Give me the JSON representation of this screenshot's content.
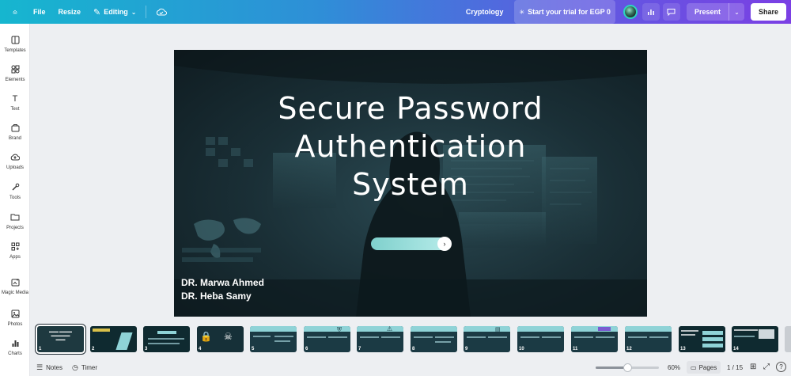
{
  "topbar": {
    "file_label": "File",
    "resize_label": "Resize",
    "editing_label": "Editing",
    "doc_title": "Cryptology",
    "trial_label": "Start your trial for EGP 0",
    "present_label": "Present",
    "share_label": "Share"
  },
  "sidebar": {
    "items": [
      {
        "label": "Templates",
        "icon": "templates-icon"
      },
      {
        "label": "Elements",
        "icon": "elements-icon"
      },
      {
        "label": "Text",
        "icon": "text-icon"
      },
      {
        "label": "Brand",
        "icon": "brand-icon"
      },
      {
        "label": "Uploads",
        "icon": "uploads-icon"
      },
      {
        "label": "Tools",
        "icon": "tools-icon"
      },
      {
        "label": "Projects",
        "icon": "projects-icon"
      },
      {
        "label": "Apps",
        "icon": "apps-icon"
      },
      {
        "label": "Magic Media",
        "icon": "magic-media-icon"
      },
      {
        "label": "Photos",
        "icon": "photos-icon"
      },
      {
        "label": "Charts",
        "icon": "charts-icon"
      }
    ]
  },
  "slide": {
    "title_line1": "Secure Password",
    "title_line2": "Authentication",
    "title_line3": "System",
    "author1": "DR. Marwa Ahmed",
    "author2": "DR. Heba Samy"
  },
  "filmstrip": {
    "thumbs": [
      {
        "num": "1"
      },
      {
        "num": "2"
      },
      {
        "num": "3"
      },
      {
        "num": "4"
      },
      {
        "num": "5"
      },
      {
        "num": "6"
      },
      {
        "num": "7"
      },
      {
        "num": "8"
      },
      {
        "num": "9"
      },
      {
        "num": "10"
      },
      {
        "num": "11"
      },
      {
        "num": "12"
      },
      {
        "num": "13"
      },
      {
        "num": "14"
      }
    ]
  },
  "bottombar": {
    "notes_label": "Notes",
    "timer_label": "Timer",
    "zoom_value": "60%",
    "zoom_fraction": 0.5,
    "pages_label": "Pages",
    "page_count": "1 / 15"
  },
  "colors": {
    "gradient_start": "#16b6cf",
    "gradient_end": "#7b3fe4",
    "slide_bg": "#1a2f36",
    "accent_teal": "#8fd3d7"
  }
}
